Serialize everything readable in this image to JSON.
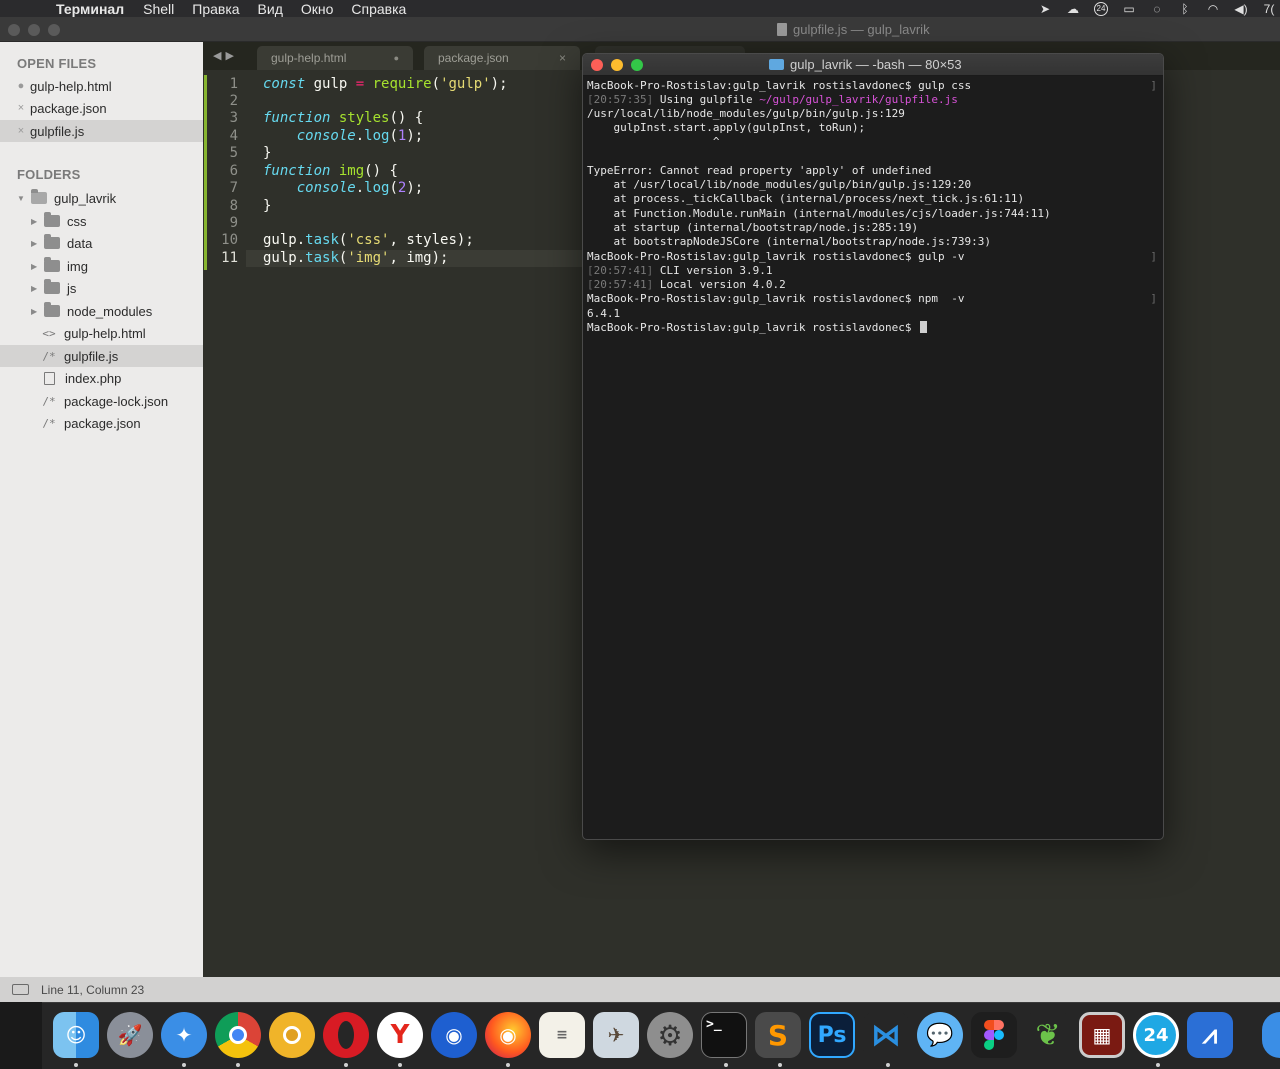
{
  "menubar": {
    "apple": "",
    "app_name": "Терминал",
    "items": [
      "Shell",
      "Правка",
      "Вид",
      "Окно",
      "Справка"
    ],
    "status_icons": [
      "location-icon",
      "creative-cloud-icon",
      "bitrix24-icon",
      "airplay-icon",
      "sync-icon",
      "bluetooth-icon",
      "wifi-icon",
      "volume-icon"
    ],
    "status_badge": "24",
    "clock_fragment": "7("
  },
  "sublime": {
    "window_title": "gulpfile.js — gulp_lavrik",
    "sidebar": {
      "open_files_title": "OPEN FILES",
      "open_files": [
        {
          "label": "gulp-help.html",
          "mark": "●"
        },
        {
          "label": "package.json",
          "mark": "×"
        },
        {
          "label": "gulpfile.js",
          "mark": "×"
        }
      ],
      "folders_title": "FOLDERS",
      "root_folder": "gulp_lavrik",
      "folders": [
        "css",
        "data",
        "img",
        "js",
        "node_modules"
      ],
      "files": [
        {
          "label": "gulp-help.html",
          "glyph": "<>"
        },
        {
          "label": "gulpfile.js",
          "glyph": "/*"
        },
        {
          "label": "index.php",
          "glyph": ""
        },
        {
          "label": "package-lock.json",
          "glyph": "/*"
        },
        {
          "label": "package.json",
          "glyph": "/*"
        }
      ]
    },
    "tabs": [
      {
        "label": "gulp-help.html",
        "indicator": "●"
      },
      {
        "label": "package.json",
        "indicator": "×"
      }
    ],
    "editor": {
      "line_numbers": [
        "1",
        "2",
        "3",
        "4",
        "5",
        "6",
        "7",
        "8",
        "9",
        "10",
        "11"
      ],
      "active_line": "11"
    },
    "status_text": "Line 11, Column 23"
  },
  "terminal": {
    "title": "gulp_lavrik — -bash — 80×53",
    "prompt": "MacBook-Pro-Rostislav:gulp_lavrik rostislavdonec$",
    "cmd_1": "gulp css",
    "ts_1": "20:57:35",
    "using_gulpfile": "Using gulpfile",
    "gulpfile_path": "~/gulp/gulp_lavrik/gulpfile.js",
    "err_location": "/usr/local/lib/node_modules/gulp/bin/gulp.js:129",
    "err_code": "    gulpInst.start.apply(gulpInst, toRun);",
    "err_caret": "                   ^",
    "type_error": "TypeError: Cannot read property 'apply' of undefined",
    "stack": [
      "    at /usr/local/lib/node_modules/gulp/bin/gulp.js:129:20",
      "    at process._tickCallback (internal/process/next_tick.js:61:11)",
      "    at Function.Module.runMain (internal/modules/cjs/loader.js:744:11)",
      "    at startup (internal/bootstrap/node.js:285:19)",
      "    at bootstrapNodeJSCore (internal/bootstrap/node.js:739:3)"
    ],
    "cmd_2": "gulp -v",
    "ts_2": "20:57:41",
    "cli_version": "CLI version 3.9.1",
    "ts_3": "20:57:41",
    "local_version": "Local version 4.0.2",
    "cmd_3": "npm  -v",
    "npm_version": "6.4.1"
  },
  "dock": {
    "apps": [
      "finder-icon",
      "launchpad-icon",
      "safari-icon",
      "chrome-icon",
      "chrome-canary-icon",
      "opera-icon",
      "yandex-browser-icon",
      "firefox-developer-icon",
      "firefox-icon",
      "textedit-icon",
      "preview-icon",
      "system-preferences-icon",
      "terminal-icon",
      "sublime-text-icon",
      "photoshop-icon",
      "vscode-icon",
      "messages-icon",
      "figma-icon",
      "leaf-icon",
      "photo-booth-icon",
      "bitrix24-icon",
      "architect-icon"
    ],
    "photoshop_label": "Ps",
    "bitrix_label": "24",
    "terminal_label": ">_"
  }
}
